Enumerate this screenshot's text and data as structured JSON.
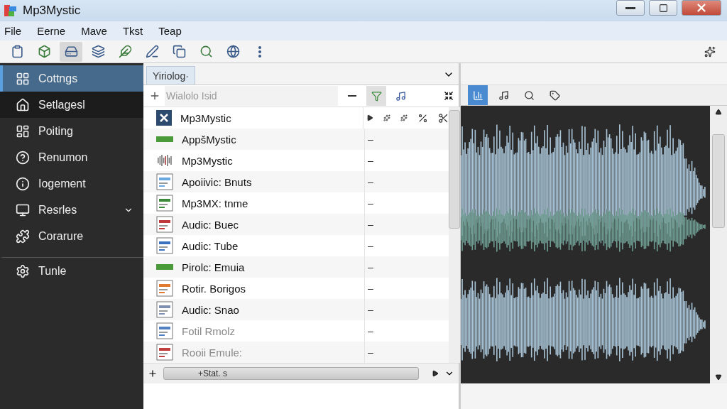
{
  "window": {
    "title": "Mp3Mystic"
  },
  "menu": [
    "File",
    "Eerne",
    "Mave",
    "Tkst",
    "Teap"
  ],
  "toolbar": [
    {
      "selected": false
    },
    {
      "selected": false
    },
    {
      "selected": true
    },
    {
      "selected": false
    },
    {
      "selected": false
    },
    {
      "selected": false
    },
    {
      "selected": false
    },
    {
      "selected": false
    },
    {
      "selected": false
    },
    {
      "selected": false
    }
  ],
  "sidebar": {
    "items": [
      {
        "label": "Cottngs",
        "selected": true,
        "hovered": false,
        "kind": "item"
      },
      {
        "label": "Setlagesl",
        "selected": false,
        "hovered": true,
        "kind": "item"
      },
      {
        "label": "Poiting",
        "selected": false,
        "hovered": false,
        "kind": "item"
      },
      {
        "label": "Renumon",
        "selected": false,
        "hovered": false,
        "kind": "item"
      },
      {
        "label": "Iogement",
        "selected": false,
        "hovered": false,
        "kind": "item"
      },
      {
        "label": "Resrles",
        "selected": false,
        "hovered": false,
        "kind": "group"
      },
      {
        "label": "Corarure",
        "selected": false,
        "hovered": false,
        "kind": "item"
      },
      {
        "label": "Tunle",
        "selected": false,
        "hovered": false,
        "kind": "footer"
      }
    ]
  },
  "list_panel": {
    "tab": {
      "label": "Yiriolog·",
      "selected": true
    },
    "filter": {
      "placeholder": "Wialolo Isid"
    },
    "rows": [
      {
        "name": "Mp3Mystic",
        "column_2": "",
        "dim": false
      },
      {
        "name": "AppšMystic",
        "column_2": "–",
        "dim": false
      },
      {
        "name": "Mp3Mystic",
        "column_2": "–",
        "dim": false
      },
      {
        "name": "Apoiivic: Bnuts",
        "column_2": "–",
        "dim": false
      },
      {
        "name": "Mp3MX: tnme",
        "column_2": "–",
        "dim": false
      },
      {
        "name": "Audic: Buec",
        "column_2": "–",
        "dim": false
      },
      {
        "name": "Audic: Tube",
        "column_2": "–",
        "dim": false
      },
      {
        "name": "Pirolc: Emuia",
        "column_2": "–",
        "dim": false
      },
      {
        "name": "Rotir. Borigos",
        "column_2": "–",
        "dim": false
      },
      {
        "name": "Audic: Snao",
        "column_2": "–",
        "dim": false
      },
      {
        "name": "Fotil  Rmolz",
        "column_2": "–",
        "dim": true
      },
      {
        "name": "Rooii  Emule:",
        "column_2": "–",
        "dim": true
      }
    ],
    "hscroll": {
      "label": "+Stat. s"
    }
  },
  "wave_panel": {
    "tools": [
      {
        "selected": true
      },
      {
        "selected": false
      },
      {
        "selected": false
      },
      {
        "selected": false
      }
    ]
  }
}
